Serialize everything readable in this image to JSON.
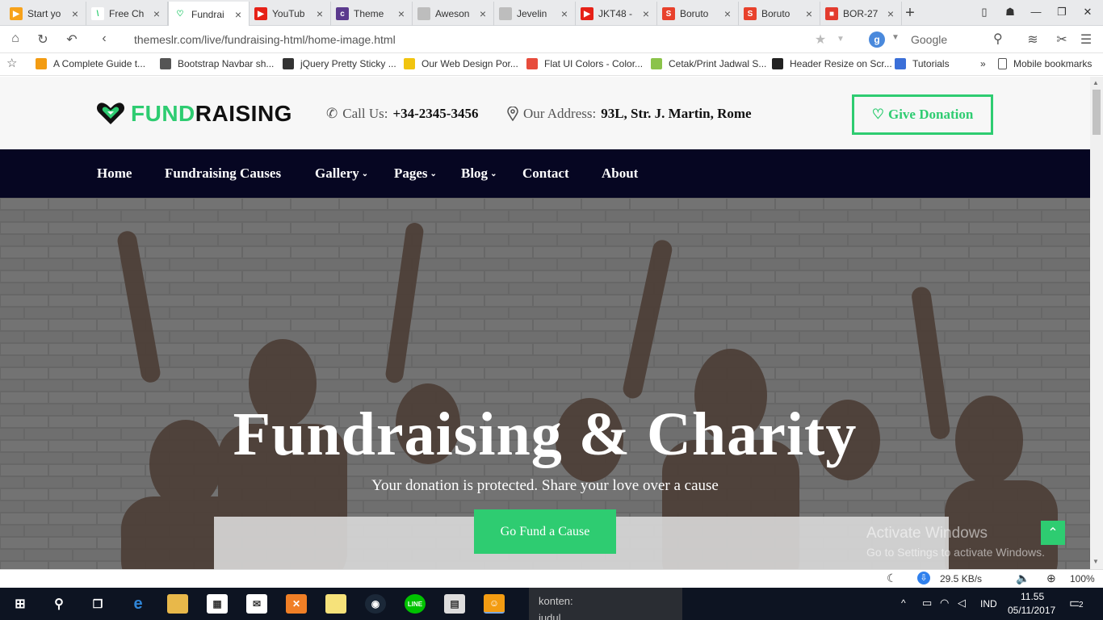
{
  "browser": {
    "tabs": [
      {
        "label": "Start yo",
        "color": "#f7a21b",
        "glyph": "▶"
      },
      {
        "label": "Free Ch",
        "color": "#ffffff",
        "glyph": "\\"
      },
      {
        "label": "Fundrai",
        "color": "#ffffff",
        "glyph": "♡"
      },
      {
        "label": "YouTub",
        "color": "#e62117",
        "glyph": "▶"
      },
      {
        "label": "Theme",
        "color": "#5b3a8e",
        "glyph": "c"
      },
      {
        "label": "Aweson",
        "color": "#bdbdbd",
        "glyph": ""
      },
      {
        "label": "Jevelin",
        "color": "#bdbdbd",
        "glyph": ""
      },
      {
        "label": "JKT48 -",
        "color": "#e62117",
        "glyph": "▶"
      },
      {
        "label": "Boruto",
        "color": "#e8412c",
        "glyph": "S"
      },
      {
        "label": "Boruto",
        "color": "#e8412c",
        "glyph": "S"
      },
      {
        "label": "BOR-27",
        "color": "#e33b2e",
        "glyph": "■"
      }
    ],
    "url": "themeslr.com/live/fundraising-html/home-image.html",
    "search_engine": "Google",
    "search_badge": "g",
    "bookmarks": [
      {
        "label": "A Complete Guide t...",
        "color": "#f39c12"
      },
      {
        "label": "Bootstrap Navbar sh...",
        "color": "#555555"
      },
      {
        "label": "jQuery Pretty Sticky ...",
        "color": "#333333"
      },
      {
        "label": "Our Web Design Por...",
        "color": "#f1c40f"
      },
      {
        "label": "Flat UI Colors - Color...",
        "color": "#e74c3c"
      },
      {
        "label": "Cetak/Print Jadwal S...",
        "color": "#8bc34a"
      },
      {
        "label": "Header Resize on Scr...",
        "color": "#222222"
      },
      {
        "label": "Tutorials",
        "color": "#3b6fd8"
      }
    ],
    "bookmarks_more": "»",
    "mobile_bookmarks": "Mobile bookmarks"
  },
  "site": {
    "brand_part1": "FUND",
    "brand_part2": "RAISING",
    "call_label": "Call Us:",
    "call_value": "+34-2345-3456",
    "address_label": "Our Address:",
    "address_value": "93L, Str. J. Martin, Rome",
    "donate_label": "Give Donation",
    "nav": [
      {
        "label": "Home",
        "caret": false
      },
      {
        "label": "Fundraising Causes",
        "caret": false
      },
      {
        "label": "Gallery",
        "caret": true
      },
      {
        "label": "Pages",
        "caret": true
      },
      {
        "label": "Blog",
        "caret": true
      },
      {
        "label": "Contact",
        "caret": false
      },
      {
        "label": "About",
        "caret": false
      }
    ],
    "hero_title": "Fundraising & Charity",
    "hero_subtitle": "Your donation is protected. Share your love over a cause",
    "cta_label": "Go Fund a Cause",
    "accent": "#2ecc71",
    "nav_bg": "#060622"
  },
  "watermark": {
    "line1": "Activate Windows",
    "line2": "Go to Settings to activate Windows."
  },
  "status": {
    "speed": "29.5 KB/s",
    "zoom": "100%"
  },
  "taskbar": {
    "peek_line1": "konten:",
    "peek_line2": "judul",
    "lang": "IND",
    "time": "11.55",
    "date": "05/11/2017",
    "notif_count": "2"
  }
}
